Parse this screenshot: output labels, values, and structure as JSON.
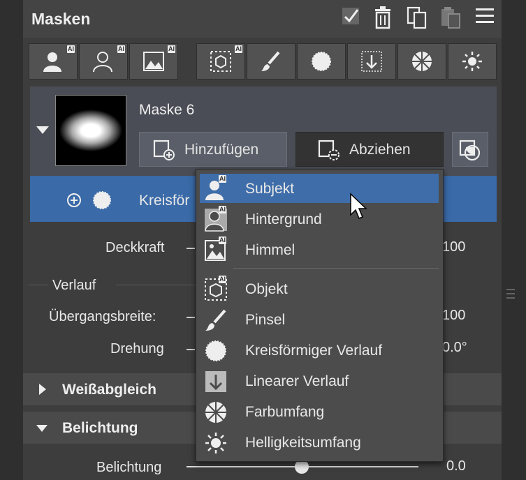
{
  "header": {
    "title": "Masken"
  },
  "mask": {
    "name": "Maske 6",
    "add_label": "Hinzufügen",
    "subtract_label": "Abziehen",
    "ai_badge": "AI"
  },
  "selected_mask": {
    "label": "Kreisför"
  },
  "properties": {
    "opacity": {
      "label": "Deckkraft",
      "value": "100"
    },
    "gradient_section": "Verlauf",
    "transition": {
      "label": "Übergangsbreite:",
      "value": "100"
    },
    "rotation": {
      "label": "Drehung",
      "value": "0.0°"
    }
  },
  "sections": [
    {
      "title": "Weißabgleich"
    },
    {
      "title": "Belichtung"
    }
  ],
  "exposure": {
    "label": "Belichtung",
    "value": "0.0"
  },
  "dropdown": {
    "items": [
      {
        "label": "Subjekt",
        "icon": "subject-ai-icon",
        "ai": "AI"
      },
      {
        "label": "Hintergrund",
        "icon": "background-ai-icon",
        "ai": "AI"
      },
      {
        "label": "Himmel",
        "icon": "sky-ai-icon",
        "ai": "AI"
      },
      {
        "label": "Objekt",
        "icon": "object-ai-icon",
        "ai": "AI"
      },
      {
        "label": "Pinsel",
        "icon": "brush-icon"
      },
      {
        "label": "Kreisförmiger Verlauf",
        "icon": "radial-gradient-icon"
      },
      {
        "label": "Linearer Verlauf",
        "icon": "linear-gradient-icon"
      },
      {
        "label": "Farbumfang",
        "icon": "color-range-icon"
      },
      {
        "label": "Helligkeitsumfang",
        "icon": "luminance-range-icon"
      }
    ]
  }
}
